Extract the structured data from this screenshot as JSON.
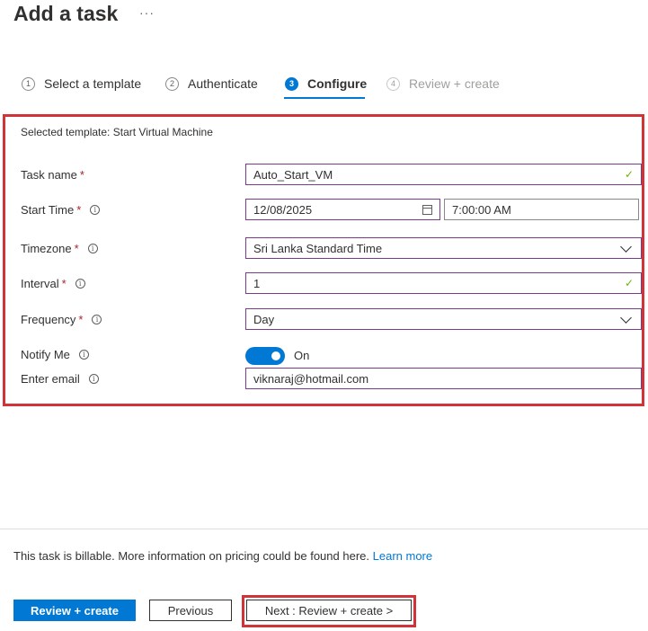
{
  "page": {
    "title": "Add a task",
    "more": "···"
  },
  "steps": [
    {
      "num": "1",
      "label": "Select a template",
      "state": "done"
    },
    {
      "num": "2",
      "label": "Authenticate",
      "state": "done"
    },
    {
      "num": "3",
      "label": "Configure",
      "state": "active"
    },
    {
      "num": "4",
      "label": "Review + create",
      "state": "disabled"
    }
  ],
  "form": {
    "selected_template": "Selected template: Start Virtual Machine",
    "task_name": {
      "label": "Task name",
      "value": "Auto_Start_VM"
    },
    "start_time": {
      "label": "Start Time",
      "date": "12/08/2025",
      "time": "7:00:00 AM"
    },
    "timezone": {
      "label": "Timezone",
      "value": "Sri Lanka Standard Time"
    },
    "interval": {
      "label": "Interval",
      "value": "1"
    },
    "frequency": {
      "label": "Frequency",
      "value": "Day"
    },
    "notify": {
      "label": "Notify Me",
      "toggle_label": "On",
      "enabled": true
    },
    "email": {
      "label": "Enter email",
      "value": "viknaraj@hotmail.com"
    },
    "required_mark": "*",
    "info_glyph": "i",
    "check_glyph": "✓"
  },
  "footer": {
    "billing_text": "This task is billable. More information on pricing could be found here.",
    "learn_more": "Learn more",
    "review_button": "Review + create",
    "previous_button": "Previous",
    "next_button": "Next : Review + create >"
  },
  "colors": {
    "accent": "#0078d4",
    "highlight": "#d13438",
    "success": "#6bb700",
    "required": "#a4262c"
  }
}
